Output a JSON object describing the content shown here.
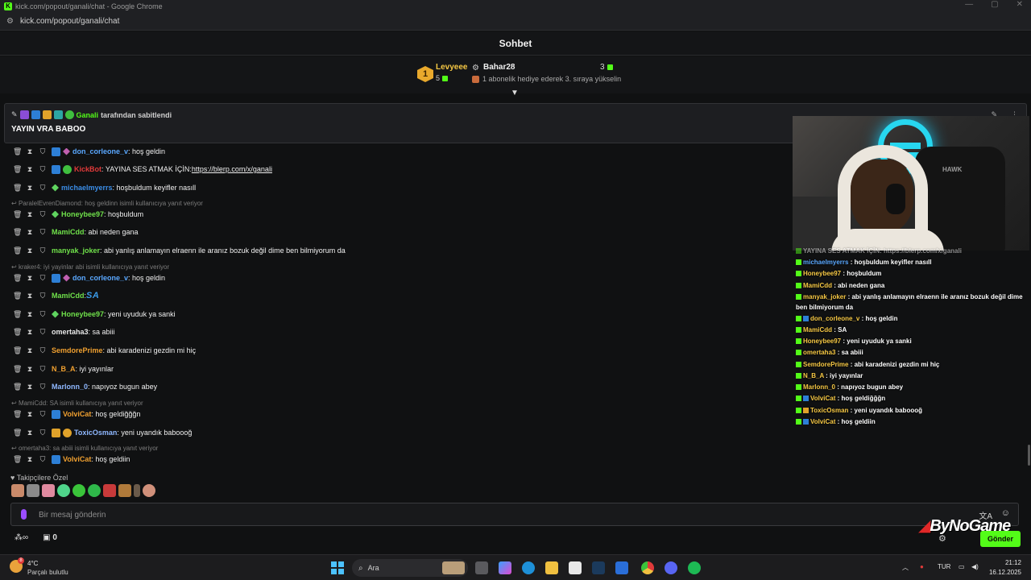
{
  "browser": {
    "title": "kick.com/popout/ganali/chat - Google Chrome",
    "url": "kick.com/popout/ganali/chat"
  },
  "chat": {
    "header": "Sohbet"
  },
  "leaderboard": {
    "top_rank": "1",
    "top_name": "Levyeee",
    "top_count": "5",
    "second_name": "Bahar28",
    "second_count": "3",
    "hint": "1 abonelik hediye ederek 3. sıraya yükselin"
  },
  "pinned": {
    "author": "Ganali",
    "suffix": "tarafından sabitlendi",
    "message": "YAYIN VRA BABOO"
  },
  "messages": [
    {
      "user": "don_corleone_v",
      "color": "#5aa8ff",
      "text": ": hoş geldin"
    },
    {
      "user": "KickBot",
      "color": "#e23a3a",
      "text": ": YAYINA SES ATMAK İÇİN: ",
      "link": "https://blerp.com/x/ganali"
    },
    {
      "user": "michaelmyerrs",
      "color": "#3b8ee8",
      "text": ": hoşbuldum keyifler nasıll"
    },
    {
      "reply": "ParalelEvrenDiamond: hoş geldinn isimli kullanıcıya yanıt veriyor"
    },
    {
      "user": "Honeybee97",
      "color": "#6fe04a",
      "text": ": hoşbuldum"
    },
    {
      "user": "MamiCdd",
      "color": "#6fe04a",
      "text": ": abi neden gana"
    },
    {
      "user": "manyak_joker",
      "color": "#6fe04a",
      "text": ": abi yanlış anlamayın elraenn ile aranız bozuk değil dime ben bilmiyorum da"
    },
    {
      "reply": "kraker4: iyi yayinlar abi isimli kullanıcıya yanıt veriyor"
    },
    {
      "user": "don_corleone_v",
      "color": "#5aa8ff",
      "text": ": hoş geldin"
    },
    {
      "user": "MamiCdd",
      "color": "#6fe04a",
      "text": ": ",
      "emote": "SA"
    },
    {
      "user": "Honeybee97",
      "color": "#6fe04a",
      "text": ": yeni uyuduk ya sanki"
    },
    {
      "user": "omertaha3",
      "color": "#e8e8e8",
      "text": ": sa abiii"
    },
    {
      "user": "SemdorePrime",
      "color": "#f0a030",
      "text": ": abi karadenizi gezdin mi hiç"
    },
    {
      "user": "N_B_A",
      "color": "#f0a030",
      "text": ": iyi yayınlar"
    },
    {
      "user": "Marlonn_0",
      "color": "#8fb8ff",
      "text": ": napıyoz bugun abey"
    },
    {
      "reply": "MamiCdd: SA isimli kullanıcıya yanıt veriyor"
    },
    {
      "user": "VolviCat",
      "color": "#f0a030",
      "text": ": hoş geldiğğğn"
    },
    {
      "user": "ToxicOsman",
      "color": "#8fb8ff",
      "text": ": yeni uyandık baboooğ"
    },
    {
      "reply": "omertaha3: sa abiii isimli kullanıcıya yanıt veriyor"
    },
    {
      "user": "VolviCat",
      "color": "#f0a030",
      "text": ": hoş geldiin"
    }
  ],
  "emote_section": {
    "label": "Takipçilere Özel"
  },
  "input": {
    "placeholder": "Bir mesaj gönderin"
  },
  "bottom": {
    "points": "0",
    "send_label": "Gönder",
    "logo": "ByNoGame"
  },
  "webcam": {
    "chair_brand": "HAWK"
  },
  "overlay": [
    {
      "user": "",
      "text": "YAYINA SES ATMAK İÇİN: https://blerp.com/x/ganali"
    },
    {
      "user": "michaelmyerrs",
      "text": " : hoşbuldum keyifler nasıll"
    },
    {
      "user": "Honeybee97",
      "text": " : hoşbuldum"
    },
    {
      "user": "MamiCdd",
      "text": " : abi neden gana"
    },
    {
      "user": "manyak_joker",
      "text": " : abi yanlış anlamayın elraenn ile aranız bozuk değil dime ben bilmiyorum da"
    },
    {
      "user": "don_corleone_v",
      "text": " : hoş geldin"
    },
    {
      "user": "MamiCdd",
      "text": " : SA"
    },
    {
      "user": "Honeybee97",
      "text": " : yeni uyuduk ya sanki"
    },
    {
      "user": "omertaha3",
      "text": " : sa abiii"
    },
    {
      "user": "SemdorePrime",
      "text": " : abi karadenizi gezdin mi hiç"
    },
    {
      "user": "N_B_A",
      "text": " : iyi yayınlar"
    },
    {
      "user": "Marlonn_0",
      "text": " : napıyoz bugun abey"
    },
    {
      "user": "VolviCat",
      "text": " : hoş geldiğğğn"
    },
    {
      "user": "ToxicOsman",
      "text": " : yeni uyandık baboooğ"
    },
    {
      "user": "VolviCat",
      "text": " : hoş geldiin"
    }
  ],
  "taskbar": {
    "temperature": "4°C",
    "weather": "Parçalı bulutlu",
    "weather_badge": "8",
    "search": "Ara",
    "language": "TUR",
    "time": "21:12",
    "date": "16.12.2025"
  },
  "colors": {
    "brand_green": "#53fc18",
    "background": "#101112"
  }
}
